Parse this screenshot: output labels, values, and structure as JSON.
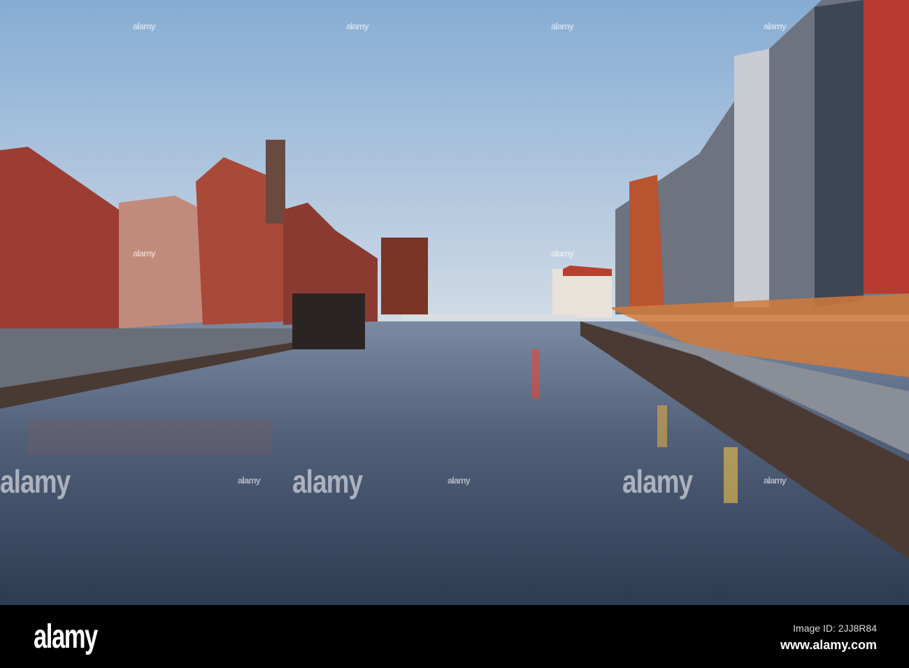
{
  "watermark": {
    "text": "alamy"
  },
  "footer": {
    "logo": "alamy",
    "image_id": "Image ID: 2JJ8R84",
    "url": "www.alamy.com"
  },
  "colors": {
    "sky_top": "#8fb3d6",
    "sky_bottom": "#c9d8e6",
    "water": "#4a5a72",
    "brick": "#a8433a"
  }
}
